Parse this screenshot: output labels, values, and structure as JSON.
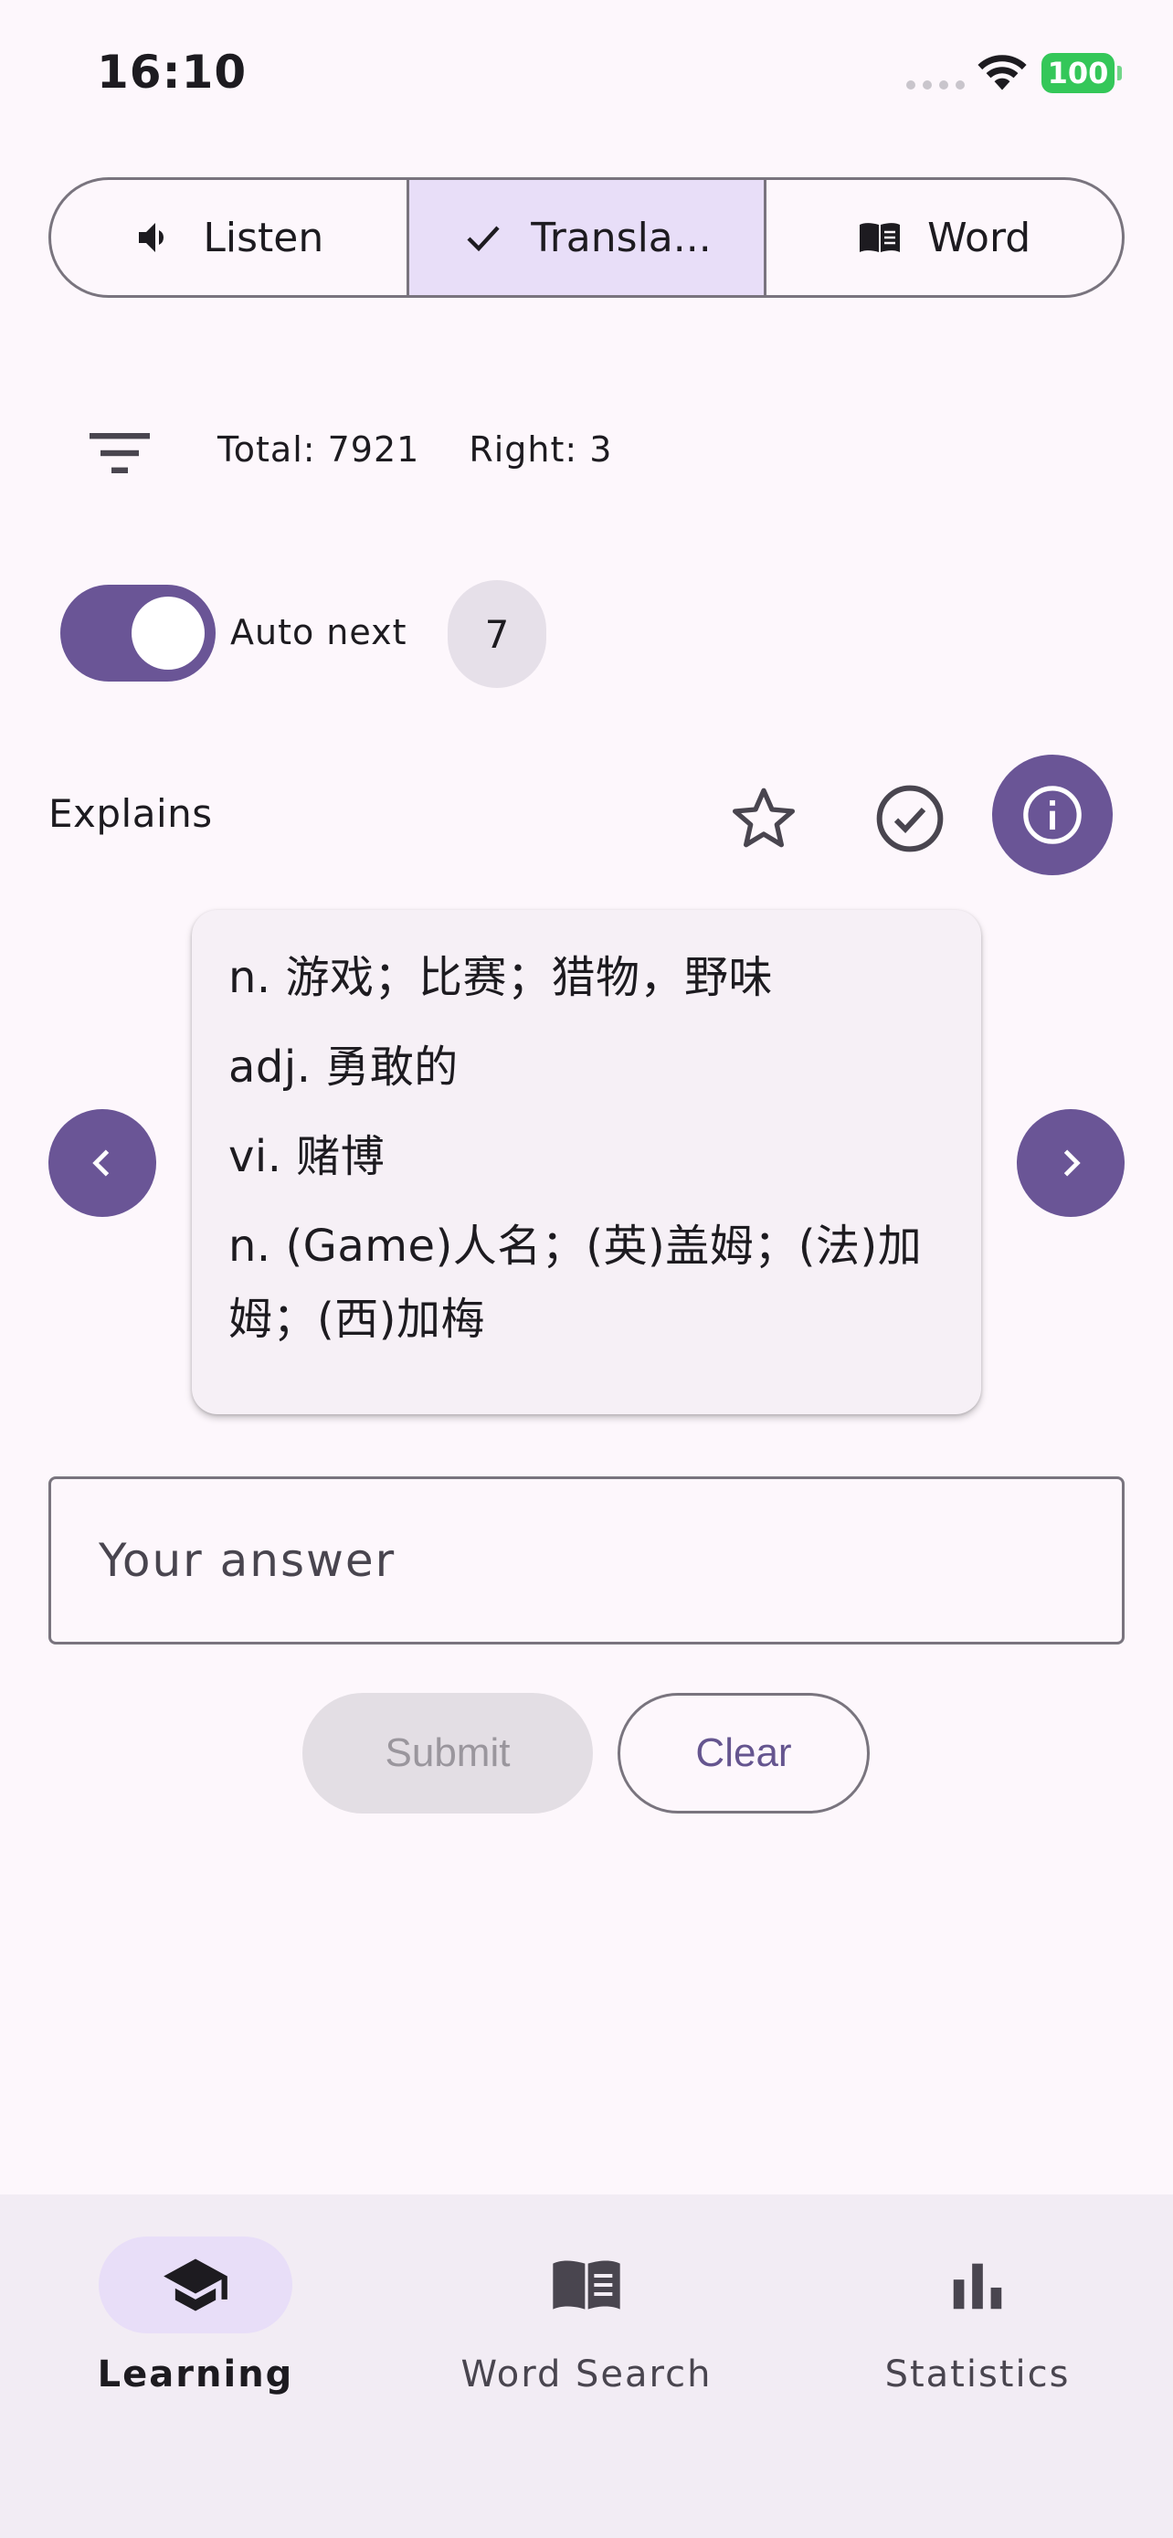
{
  "status_bar": {
    "time": "16:10",
    "battery": "100"
  },
  "mode_tabs": [
    {
      "label": "Listen",
      "icon": "speaker-icon",
      "selected": false
    },
    {
      "label": "Transla...",
      "icon": "check-icon",
      "selected": true
    },
    {
      "label": "Word",
      "icon": "book-icon",
      "selected": false
    }
  ],
  "stats": {
    "total": "Total: 7921",
    "right": "Right: 3"
  },
  "auto_next": {
    "label": "Auto next",
    "enabled": true,
    "count": "7"
  },
  "explains": {
    "title": "Explains",
    "lines": [
      "n. 游戏；比赛；猎物，野味",
      "adj. 勇敢的",
      "vi. 赌博",
      "n. (Game)人名；(英)盖姆；(法)加姆；(西)加梅"
    ]
  },
  "answer": {
    "placeholder": "Your answer",
    "value": ""
  },
  "actions": {
    "submit": "Submit",
    "clear": "Clear"
  },
  "bottom_nav": [
    {
      "label": "Learning",
      "icon": "graduation-cap-icon",
      "active": true
    },
    {
      "label": "Word Search",
      "icon": "book-icon",
      "active": false
    },
    {
      "label": "Statistics",
      "icon": "bar-chart-icon",
      "active": false
    }
  ],
  "colors": {
    "primary": "#6a5596",
    "secondary_container": "#e8def8",
    "background": "#fdf7fc",
    "battery": "#34c759"
  }
}
